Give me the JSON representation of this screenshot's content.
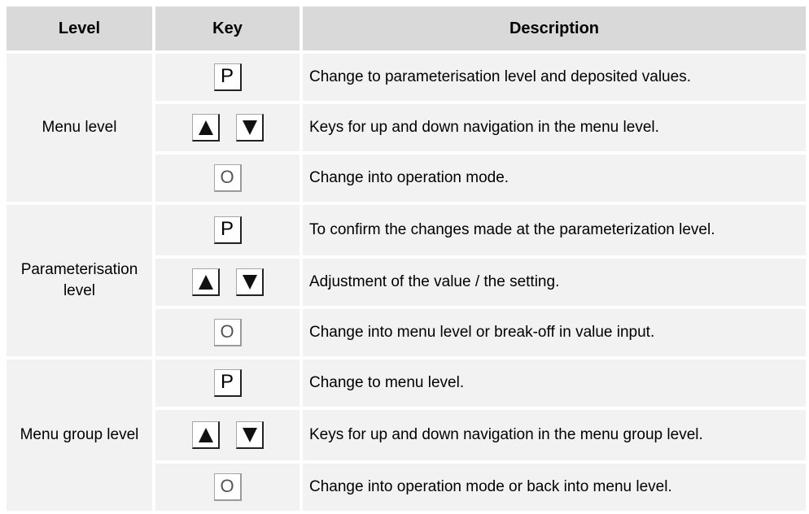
{
  "headers": {
    "level": "Level",
    "key": "Key",
    "description": "Description"
  },
  "keys": {
    "p": "P",
    "o": "O"
  },
  "groups": [
    {
      "level": "Menu level",
      "rows": [
        {
          "key": "p",
          "description": "Change to parameterisation level and deposited values."
        },
        {
          "key": "updown",
          "description": "Keys for up and down navigation in the menu level."
        },
        {
          "key": "o",
          "description": "Change into operation mode."
        }
      ]
    },
    {
      "level": "Parameterisation level",
      "rows": [
        {
          "key": "p",
          "description": "To confirm the changes made at the parameterization level."
        },
        {
          "key": "updown",
          "description": "Adjustment of the value / the setting."
        },
        {
          "key": "o",
          "description": "Change into menu level or break-off in value input."
        }
      ]
    },
    {
      "level": "Menu group level",
      "rows": [
        {
          "key": "p",
          "description": "Change to menu level."
        },
        {
          "key": "updown",
          "description": "Keys for up and down navigation in the menu group level."
        },
        {
          "key": "o",
          "description": "Change into operation mode or back into menu level."
        }
      ]
    }
  ]
}
